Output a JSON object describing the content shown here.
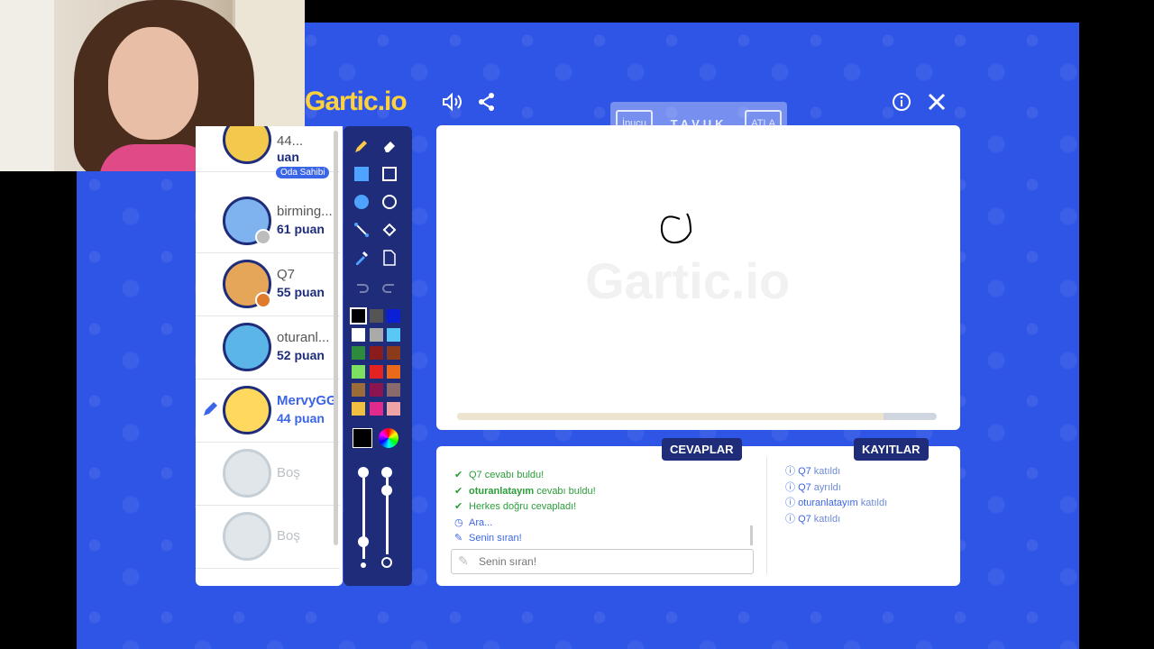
{
  "logo": "Gartic.io",
  "header": {
    "sound_icon": "speaker-icon",
    "share_icon": "share-icon",
    "info_icon": "info-icon",
    "close_icon": "close-icon"
  },
  "hint_bar": {
    "hint_label": "İpucu",
    "word": "TAVUK",
    "skip_label": "ATLA"
  },
  "players": [
    {
      "name": "44...",
      "score": "uan",
      "badge": "Oda Sahibi",
      "color": "#f2c94c"
    },
    {
      "name": "birming...",
      "score": "61 puan",
      "dot": "#bdbdbd",
      "color": "#7fb3f0"
    },
    {
      "name": "Q7",
      "score": "55 puan",
      "dot": "#e07a2c",
      "color": "#e5a65a"
    },
    {
      "name": "oturanl...",
      "score": "52 puan",
      "color": "#5bb5e6"
    },
    {
      "name": "MervyGG",
      "score": "44 puan",
      "drawing": true,
      "color": "#ffd95e"
    },
    {
      "name": "Boş",
      "score": ""
    },
    {
      "name": "Boş",
      "score": ""
    }
  ],
  "palette": [
    "#000000",
    "#555555",
    "#0a1fd6",
    "#ffffff",
    "#aaaaaa",
    "#5ac8f5",
    "#2e8b3e",
    "#8b1c1c",
    "#8b3b1a",
    "#7ee060",
    "#e52222",
    "#e96a1a",
    "#9c6b3a",
    "#8a1550",
    "#8a6a6a",
    "#f0c040",
    "#e02a8c",
    "#eea4a4"
  ],
  "answers": {
    "tab_label": "CEVAPLAR",
    "messages": [
      {
        "icon": "check",
        "text": "Q7",
        "suffix": " cevabı buldu!",
        "bold": false
      },
      {
        "icon": "check",
        "text": "oturanlatayım",
        "suffix": " cevabı buldu!",
        "bold": true
      },
      {
        "icon": "check",
        "text": "Herkes doğru cevapladı!",
        "suffix": "",
        "bold": false
      },
      {
        "icon": "clock",
        "text": "Ara...",
        "suffix": "",
        "bold": false
      },
      {
        "icon": "pencil",
        "text": "Senin sıran!",
        "suffix": "",
        "bold": false
      }
    ],
    "input_placeholder": "Senin sıran!"
  },
  "records": {
    "tab_label": "KAYITLAR",
    "items": [
      {
        "name": "Q7",
        "action": " katıldı"
      },
      {
        "name": "Q7",
        "action": " ayrıldı"
      },
      {
        "name": "oturanlatayım",
        "action": " katıldı"
      },
      {
        "name": "Q7",
        "action": " katıldı"
      }
    ]
  },
  "timer_progress": 0.89,
  "accent": "#1e2c7a",
  "background": "#2f55e6"
}
